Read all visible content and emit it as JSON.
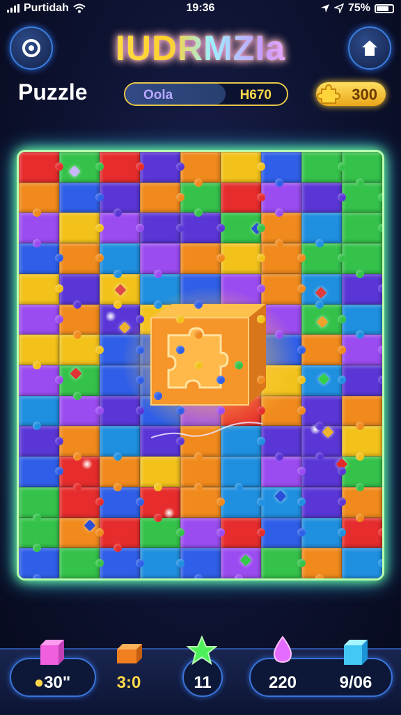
{
  "status": {
    "carrier": "Purtidah",
    "time": "19:36",
    "battery": "75%"
  },
  "header": {
    "logo": "IUDRMZIa",
    "title": "Puzzle",
    "progress_left": "Oola",
    "progress_right": "H670",
    "progress_fill": 0.62,
    "coins": "300"
  },
  "icons": {
    "back": "back-icon",
    "home": "home-icon",
    "coin": "coin-puzzle-icon",
    "center": "glowing-puzzle-cube-icon"
  },
  "colors": {
    "puzzle": [
      "#2f5fe8",
      "#34c24a",
      "#9b4cf0",
      "#f08a1c",
      "#e62c2c",
      "#1f8fe0",
      "#f2c21b",
      "#5a36d6"
    ],
    "accent": "#6fff7a"
  },
  "bottom": {
    "stat1": "30\"",
    "stat2": "3:0",
    "stat3": "11",
    "stat4": "220",
    "stat5": "9/06"
  }
}
